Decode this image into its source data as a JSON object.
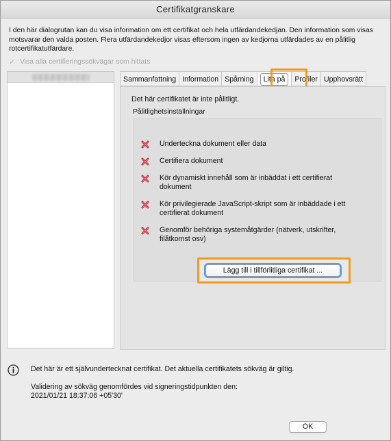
{
  "window": {
    "title": "Certifikatgranskare"
  },
  "intro_text": "I den här dialogrutan kan du visa information om ett certifikat och hela utfärdandekedjan. Den information som visas motsvarar den valda posten. Flera utfärdandekedjor visas eftersom ingen av kedjorna utfärdades av en pålitlig rotcertifikatutfärdare.",
  "show_all_paths": {
    "label": "Visa alla certifieringssökvägar som hittats",
    "checked": true,
    "enabled": false
  },
  "tabs": [
    {
      "label": "Sammanfattning",
      "active": false
    },
    {
      "label": "Information",
      "active": false
    },
    {
      "label": "Spårning",
      "active": false
    },
    {
      "label": "Lita på",
      "active": true
    },
    {
      "label": "Profiler",
      "active": false
    },
    {
      "label": "Upphovsrätt",
      "active": false
    }
  ],
  "trust": {
    "status": "Det här certifikatet är inte pålitligt.",
    "settings_label": "Pålitlighetsinställningar",
    "permissions": [
      {
        "label": "Underteckna dokument eller data",
        "allowed": false
      },
      {
        "label": "Certifiera dokument",
        "allowed": false
      },
      {
        "label": "Kör dynamiskt innehåll som är inbäddat i ett certifierat dokument",
        "allowed": false
      },
      {
        "label": "Kör privilegierade JavaScript-skript som är inbäddade i ett certifierat dokument",
        "allowed": false
      },
      {
        "label": "Genomför behöriga systemåtgärder (nätverk, utskrifter, filåtkomst osv)",
        "allowed": false
      }
    ],
    "add_button_label": "Lägg till i tillförlitliga certifikat ..."
  },
  "footer": {
    "self_signed_text": "Det här är ett självundertecknat certifikat. Det aktuella certifikatets sökväg är giltig.",
    "validation_line1": "Validering av sökväg genomfördes vid signeringstidpunkten den:",
    "validation_line2": "2021/01/21 18:37:06 +05'30'",
    "ok_label": "OK"
  },
  "colors": {
    "highlight": "#f29a1e",
    "deny_icon": "#c0283a",
    "focus_ring": "#5b9be6"
  }
}
